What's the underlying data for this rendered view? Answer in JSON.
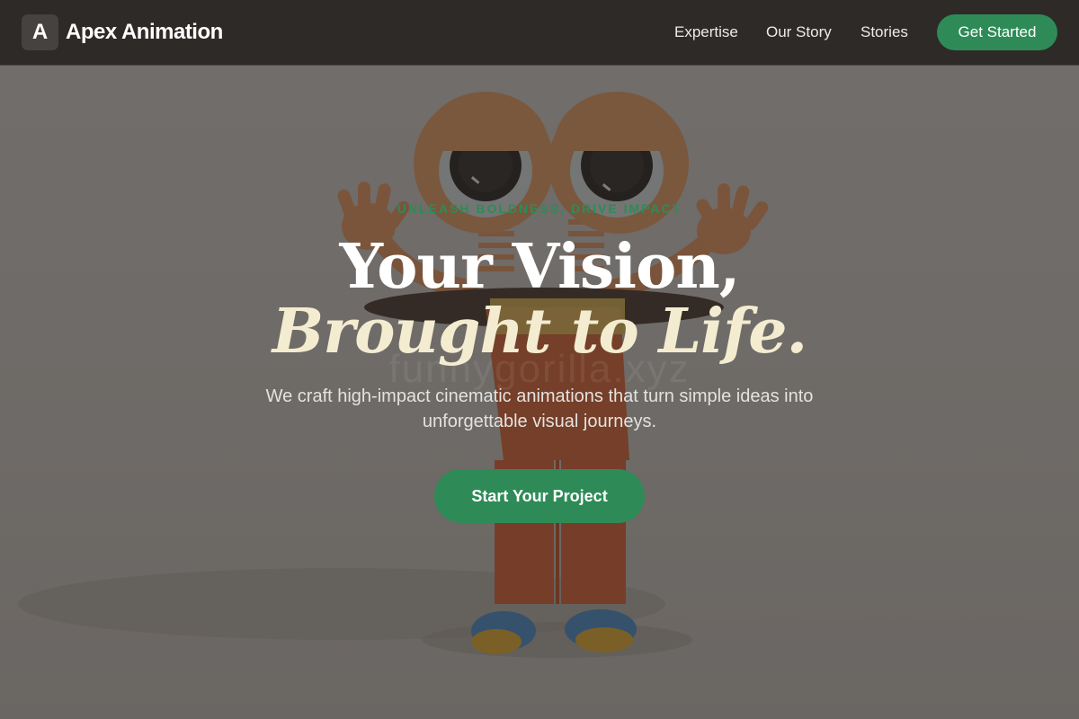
{
  "header": {
    "logo_letter": "A",
    "brand": "Apex Animation",
    "nav": [
      "Expertise",
      "Our Story",
      "Stories"
    ],
    "cta": "Get Started"
  },
  "hero": {
    "eyebrow": "UNLEASH BOLDNESS, DRIVE IMPACT",
    "headline_line1": "Your Vision,",
    "headline_line2": "Brought to Life.",
    "subtext": "We craft high-impact cinematic animations that turn simple ideas into unforgettable visual journeys.",
    "cta": "Start Your Project",
    "watermark": "funnygorilla.xyz"
  },
  "colors": {
    "header_bg": "#2e2a28",
    "accent_green": "#2e8b57",
    "headline_italic": "#f3ecd0"
  }
}
